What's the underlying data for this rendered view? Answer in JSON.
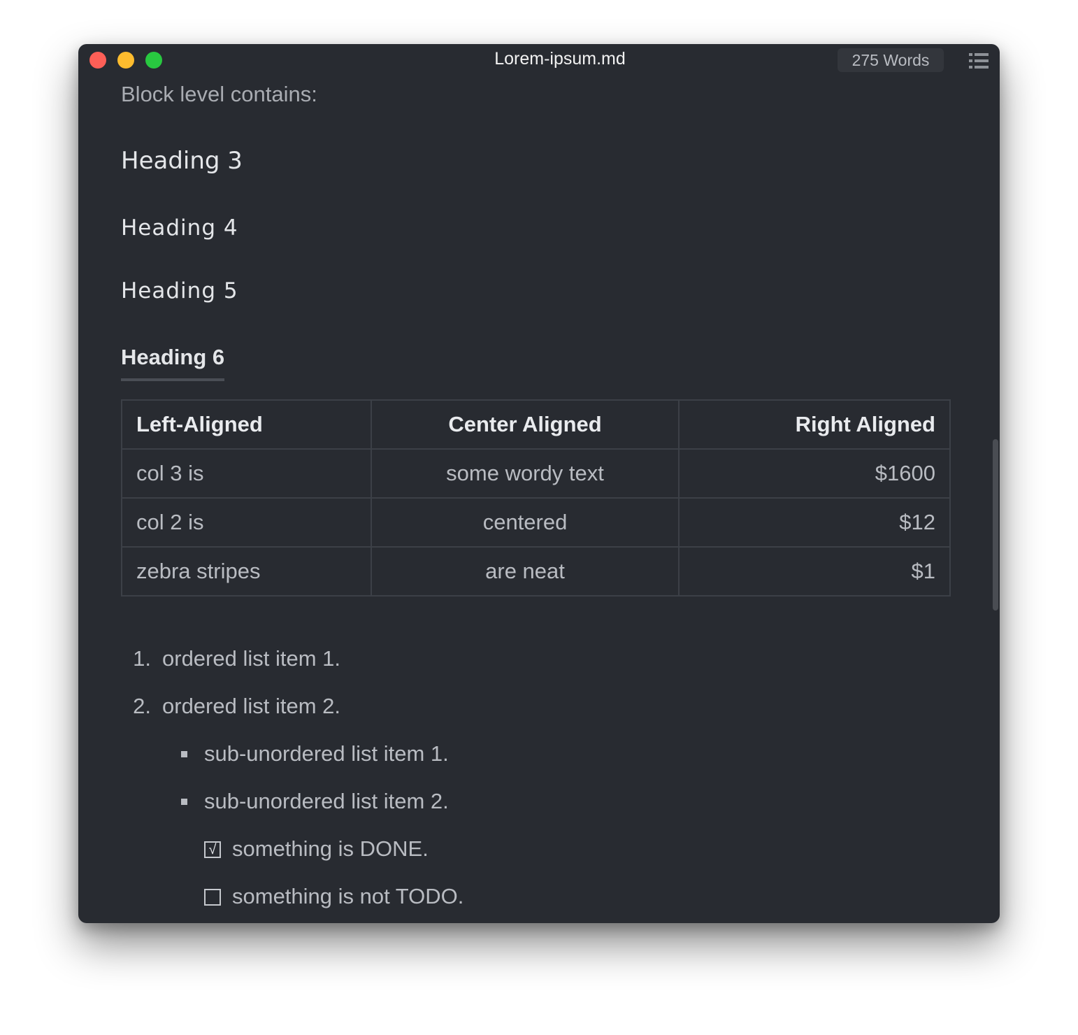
{
  "window": {
    "title": "Lorem-ipsum.md",
    "word_count": "275 Words",
    "traffic_colors": {
      "close": "#fe5f57",
      "minimize": "#febc2e",
      "maximize": "#28c840"
    }
  },
  "document": {
    "block_label": "Block level contains:",
    "headings": {
      "h3": "Heading 3",
      "h4": "Heading 4",
      "h5": "Heading 5",
      "h6": "Heading 6"
    },
    "table": {
      "headers": [
        "Left-Aligned",
        "Center Aligned",
        "Right Aligned"
      ],
      "rows": [
        [
          "col 3 is",
          "some wordy text",
          "$1600"
        ],
        [
          "col 2 is",
          "centered",
          "$12"
        ],
        [
          "zebra stripes",
          "are neat",
          "$1"
        ]
      ]
    },
    "ordered_list": [
      {
        "num": "1.",
        "text": "ordered list item 1."
      },
      {
        "num": "2.",
        "text": "ordered list item 2."
      }
    ],
    "sub_unordered_list": [
      "sub-unordered list item 1.",
      "sub-unordered list item 2."
    ],
    "tasks": [
      {
        "text": "something is DONE.",
        "checked": true,
        "mark": "√"
      },
      {
        "text": "something is not TODO.",
        "checked": false,
        "mark": ""
      }
    ]
  }
}
